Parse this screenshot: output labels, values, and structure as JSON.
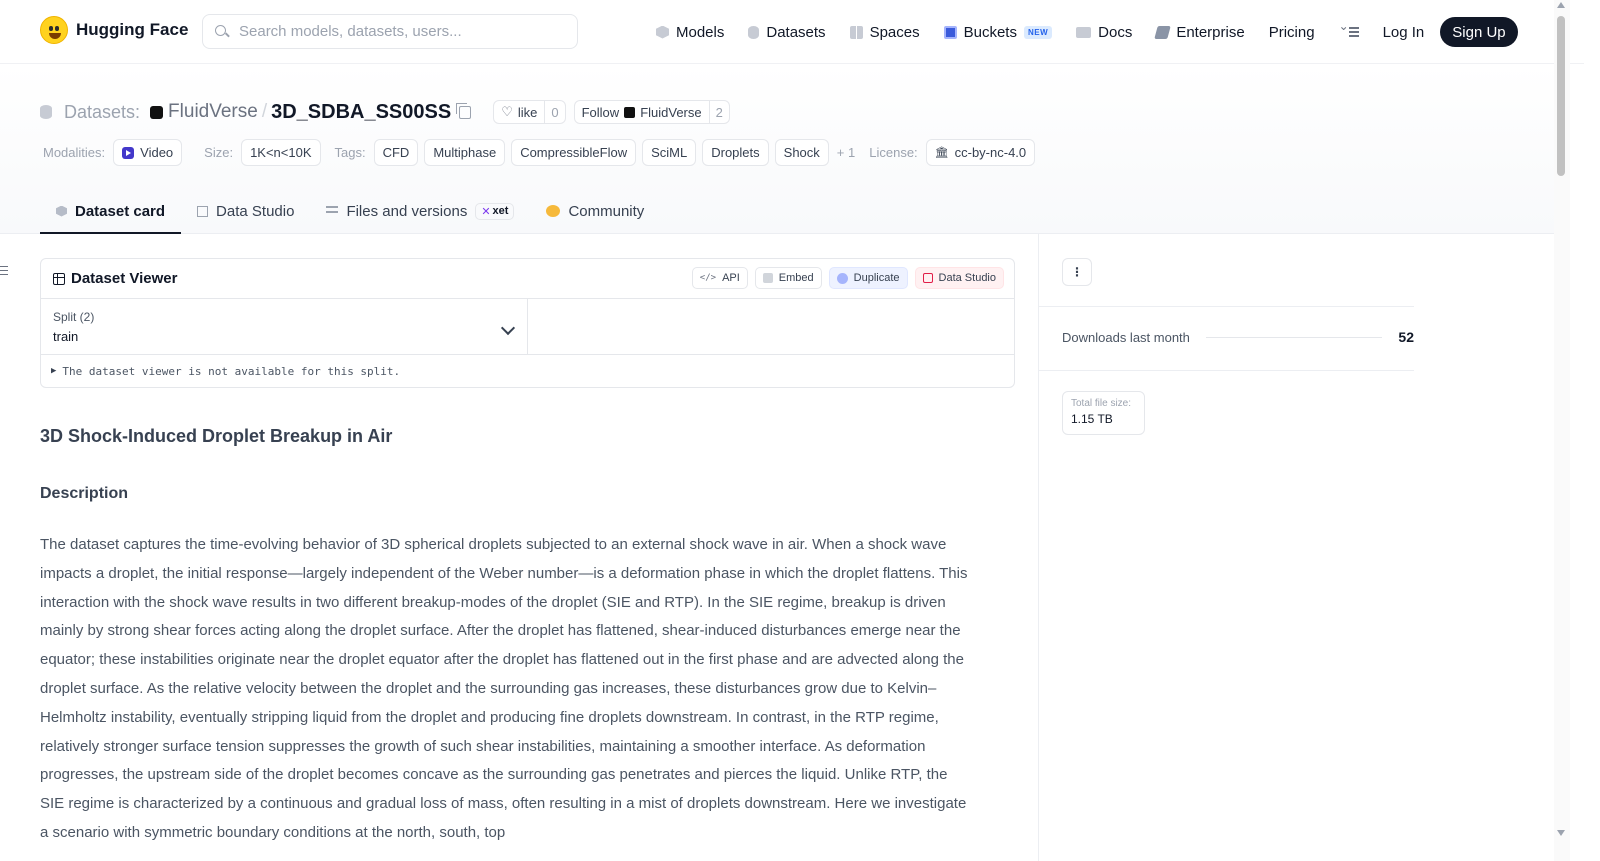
{
  "brand": {
    "name": "Hugging Face"
  },
  "search": {
    "placeholder": "Search models, datasets, users..."
  },
  "nav": {
    "items": [
      {
        "label": "Models",
        "icon": "cube-icon"
      },
      {
        "label": "Datasets",
        "icon": "database-icon"
      },
      {
        "label": "Spaces",
        "icon": "grid-icon"
      },
      {
        "label": "Buckets",
        "icon": "bucket-icon",
        "badge": "NEW"
      },
      {
        "label": "Docs",
        "icon": "book-icon"
      },
      {
        "label": "Enterprise",
        "icon": "enterprise-icon"
      },
      {
        "label": "Pricing"
      }
    ],
    "login": "Log In",
    "signup": "Sign Up"
  },
  "repo": {
    "type_label": "Datasets:",
    "org": "FluidVerse",
    "separator": "/",
    "name": "3D_SDBA_SS00SS",
    "like_label": "like",
    "like_count": "0",
    "follow_label": "Follow",
    "follow_org": "FluidVerse",
    "follow_count": "2"
  },
  "meta": {
    "modalities_label": "Modalities:",
    "modality": "Video",
    "size_label": "Size:",
    "size": "1K<n<10K",
    "tags_label": "Tags:",
    "tags": [
      "CFD",
      "Multiphase",
      "CompressibleFlow",
      "SciML",
      "Droplets",
      "Shock"
    ],
    "more_tags": "+ 1",
    "license_label": "License:",
    "license": "cc-by-nc-4.0"
  },
  "tabs": [
    {
      "label": "Dataset card",
      "active": true
    },
    {
      "label": "Data Studio"
    },
    {
      "label": "Files and versions",
      "badge": "xet"
    },
    {
      "label": "Community"
    }
  ],
  "viewer": {
    "title": "Dataset Viewer",
    "buttons": {
      "api": "API",
      "embed": "Embed",
      "duplicate": "Duplicate",
      "studio": "Data Studio"
    },
    "split_label": "Split (2)",
    "split_value": "train",
    "notice": "The dataset viewer is not available for this split."
  },
  "content": {
    "title": "3D Shock-Induced Droplet Breakup in Air",
    "section": "Description",
    "paragraph": "The dataset captures the time-evolving behavior of 3D spherical droplets subjected to an external shock wave in air. When a shock wave impacts a droplet, the initial response—largely independent of the Weber number—is a deformation phase in which the droplet flattens. This interaction with the shock wave results in two different breakup-modes of the droplet (SIE and RTP). In the SIE regime, breakup is driven mainly by strong shear forces acting along the droplet surface. After the droplet has flattened, shear-induced disturbances emerge near the equator; these instabilities originate near the droplet equator after the droplet has flattened out in the first phase and are advected along the droplet surface. As the relative velocity between the droplet and the surrounding gas increases, these disturbances grow due to Kelvin–Helmholtz instability, eventually stripping liquid from the droplet and producing fine droplets downstream. In contrast, in the RTP regime, relatively stronger surface tension suppresses the growth of such shear instabilities, maintaining a smoother interface. As deformation progresses, the upstream side of the droplet becomes concave as the surrounding gas penetrates and pierces the liquid. Unlike RTP, the SIE regime is characterized by a continuous and gradual loss of mass, often resulting in a mist of droplets downstream. Here we investigate a scenario with symmetric boundary conditions at the north, south, top"
  },
  "sidebar": {
    "downloads_label": "Downloads last month",
    "downloads_value": "52",
    "filesize_label": "Total file size:",
    "filesize_value": "1.15 TB"
  }
}
